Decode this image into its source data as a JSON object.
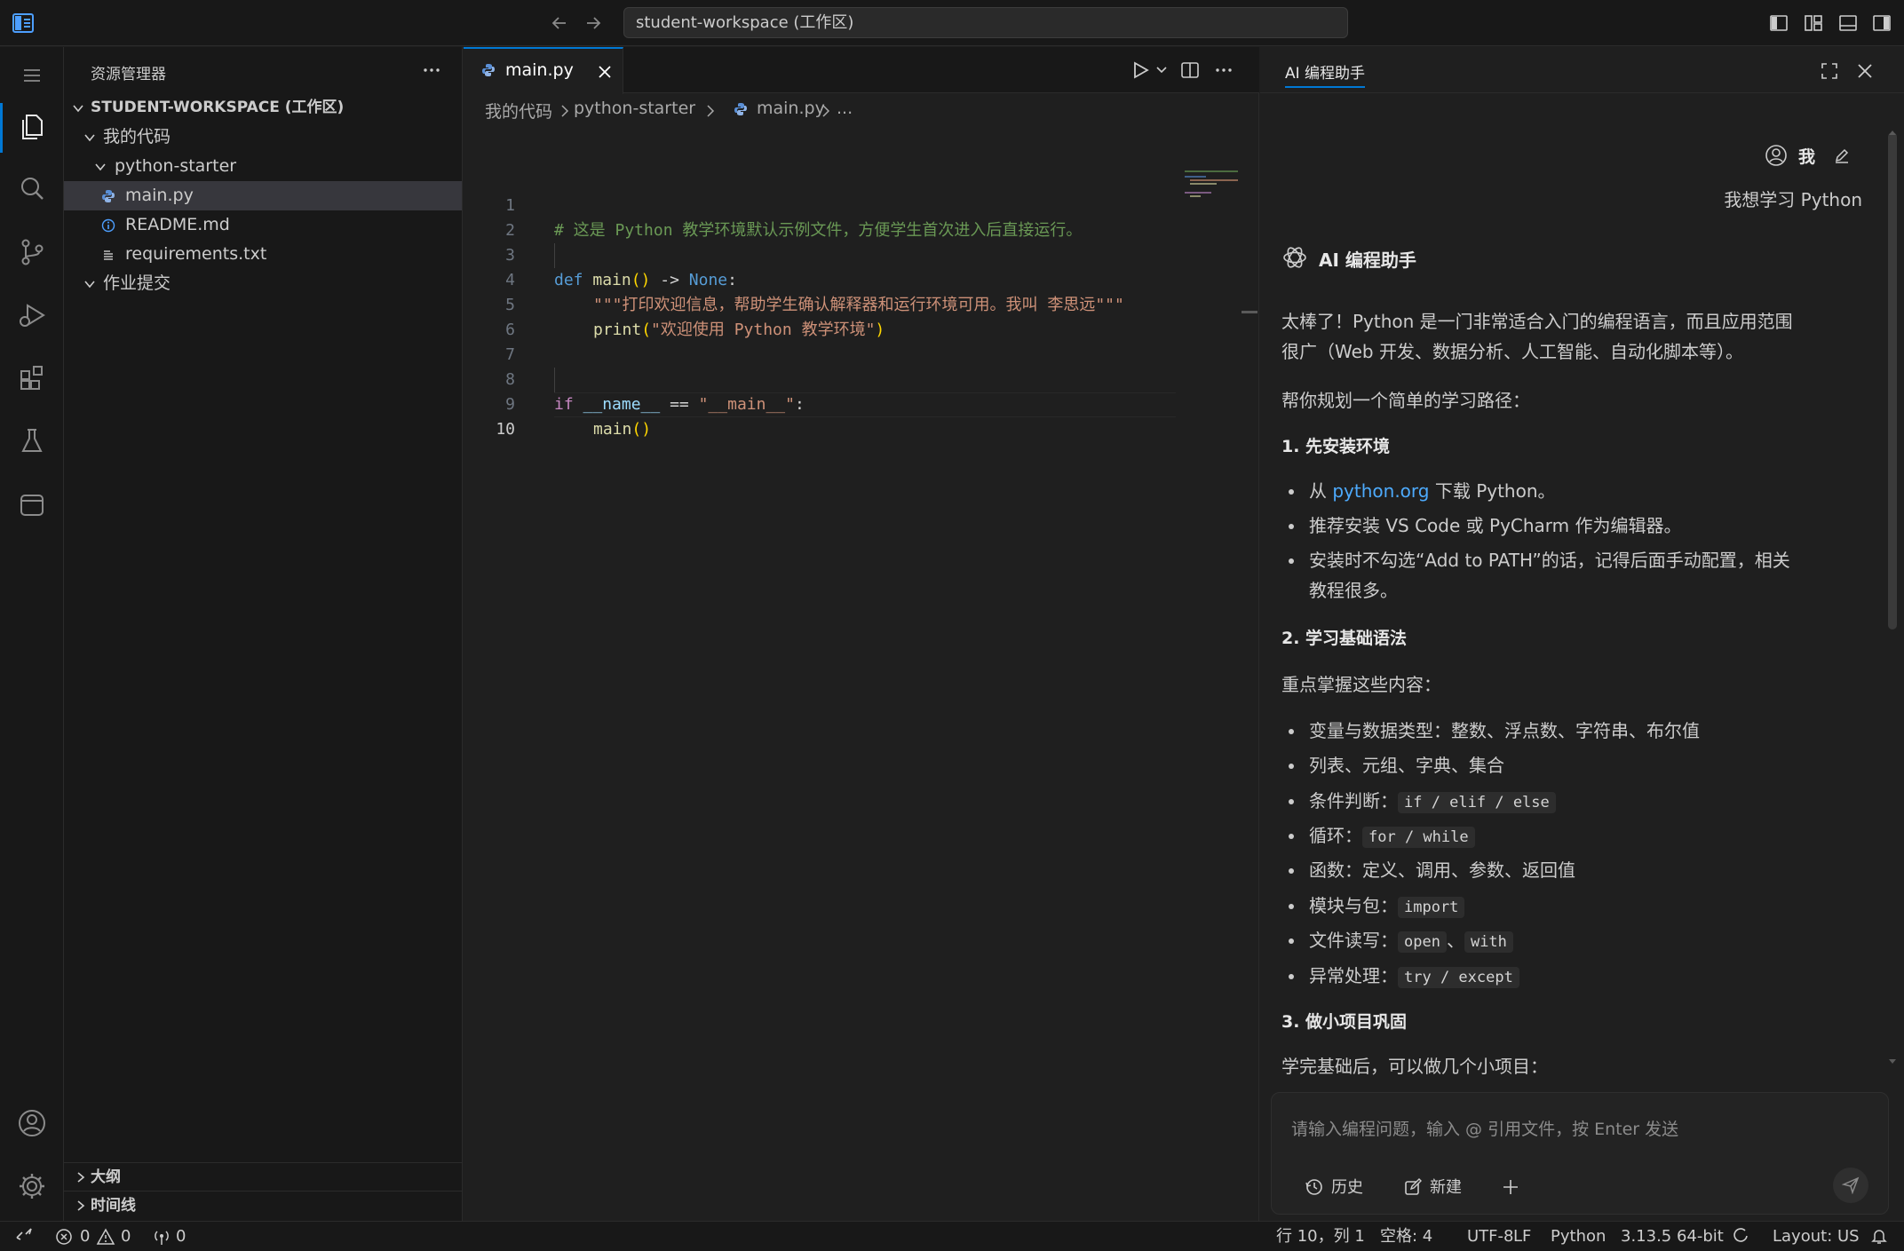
{
  "titlebar": {
    "search_text": "student-workspace (工作区)"
  },
  "sidebar": {
    "header": "资源管理器",
    "workspace": "STUDENT-WORKSPACE (工作区)",
    "folder_code": "我的代码",
    "folder_starter": "python-starter",
    "files": [
      "main.py",
      "README.md",
      "requirements.txt"
    ],
    "folder_submit": "作业提交",
    "section_outline": "大纲",
    "section_timeline": "时间线"
  },
  "editor": {
    "tab_label": "main.py",
    "breadcrumb": [
      "我的代码",
      "python-starter",
      "main.py",
      "..."
    ],
    "line_numbers": [
      "1",
      "2",
      "3",
      "4",
      "5",
      "6",
      "7",
      "8",
      "9",
      "10"
    ],
    "code": {
      "l1": "# 这是 Python 教学环境默认示例文件，方便学生首次进入后直接运行。",
      "l3_def": "def",
      "l3_fn": "main",
      "l3_paren": "()",
      "l3_arrow": " -> ",
      "l3_none": "None",
      "l3_colon": ":",
      "l4": "\"\"\"打印欢迎信息，帮助学生确认解释器和运行环境可用。我叫 李思远\"\"\"",
      "l5_fn": "print",
      "l5_open": "(",
      "l5_str": "\"欢迎使用 Python 教学环境\"",
      "l5_close": ")",
      "l8_if": "if",
      "l8_name": "__name__",
      "l8_eq": " == ",
      "l8_str": "\"__main__\"",
      "l8_colon": ":",
      "l9_fn": "main",
      "l9_paren": "()"
    }
  },
  "chat": {
    "panel_title": "AI 编程助手",
    "user_name": "我",
    "user_message": "我想学习 Python",
    "ai_name": "AI 编程助手",
    "p1": "太棒了！Python 是一门非常适合入门的编程语言，而且应用范围",
    "p1b": "很广（Web 开发、数据分析、人工智能、自动化脚本等）。",
    "p2": "帮你规划一个简单的学习路径：",
    "h1": "1. 先安装环境",
    "s1_pre": "从 ",
    "s1_link": "python.org",
    "s1_post": " 下载 Python。",
    "s1_b2": "推荐安装 VS Code 或 PyCharm 作为编辑器。",
    "s1_b3a": "安装时不勾选“Add to PATH”的话，记得后面手动配置，相关",
    "s1_b3b": "教程很多。",
    "h2": "2. 学习基础语法",
    "p3": "重点掌握这些内容：",
    "b1": "变量与数据类型：整数、浮点数、字符串、布尔值",
    "b2": "列表、元组、字典、集合",
    "b3_label": "条件判断：",
    "b3_code": "if / elif / else",
    "b4_label": "循环：",
    "b4_code": "for / while",
    "b5": "函数：定义、调用、参数、返回值",
    "b6_label": "模块与包：",
    "b6_code": "import",
    "b7_label": "文件读写：",
    "b7_code1": "open",
    "b7_sep": "、",
    "b7_code2": "with",
    "b8_label": "异常处理：",
    "b8_code": "try / except",
    "h3": "3. 做小项目巩固",
    "p4": "学完基础后，可以做几个小项目：",
    "input_placeholder": "请输入编程问题，输入 @ 引用文件，按 Enter 发送",
    "btn_history": "历史",
    "btn_new": "新建"
  },
  "statusbar": {
    "errors": "0",
    "warnings": "0",
    "ports": "0",
    "position": "行 10，列 1",
    "spaces": "空格: 4",
    "encoding": "UTF-8",
    "eol": "LF",
    "language": "Python",
    "interpreter": "3.13.5 64-bit",
    "layout": "Layout: US"
  },
  "colors": {
    "accent": "#0078d4",
    "link": "#4daafc",
    "comment": "#6a9955",
    "keyword": "#569cd6",
    "string": "#ce9178",
    "function": "#dcdcaa"
  }
}
